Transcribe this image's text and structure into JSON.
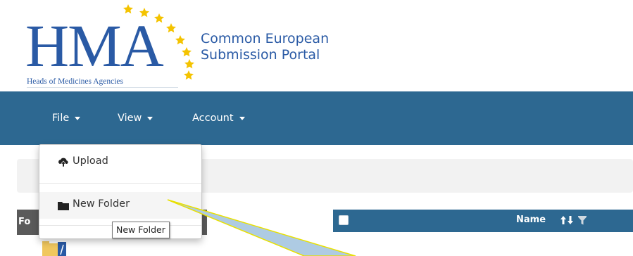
{
  "logo": {
    "acronym": "HMA",
    "org_name": "Heads of Medicines Agencies",
    "portal_line1": "Common European",
    "portal_line2": "Submission Portal"
  },
  "navbar": {
    "file": "File",
    "view": "View",
    "account": "Account"
  },
  "file_menu": {
    "upload": {
      "label": "Upload",
      "icon": "cloud-upload-icon"
    },
    "new_folder": {
      "label": "New Folder",
      "icon": "folder-icon"
    }
  },
  "tooltip": "New Folder",
  "left_panel": {
    "header_label": "Fo"
  },
  "table": {
    "name_column": "Name"
  },
  "colors": {
    "navbar": "#2d6891",
    "brand_blue": "#2a5aa5",
    "star_yellow": "#f4c300",
    "callout_fill": "#aecbe3",
    "callout_outline": "#e8e000"
  }
}
